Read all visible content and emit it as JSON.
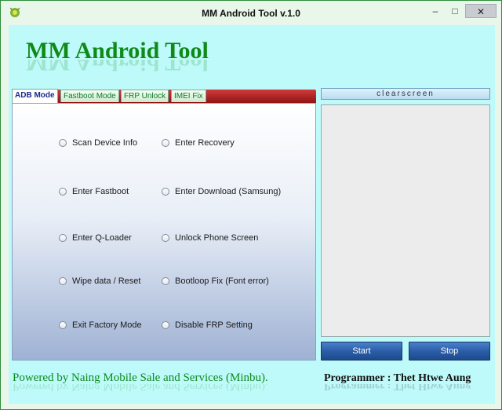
{
  "window": {
    "title": "MM Android Tool v.1.0",
    "controls": {
      "minimize": "–",
      "maximize": "□",
      "close": "✕"
    }
  },
  "app": {
    "title": "MM Android Tool"
  },
  "tabs": [
    {
      "label": "ADB Mode",
      "active": true
    },
    {
      "label": "Fastboot Mode",
      "active": false
    },
    {
      "label": "FRP Unlock",
      "active": false
    },
    {
      "label": "IMEI Fix",
      "active": false
    }
  ],
  "options": {
    "left": [
      "Scan Device Info",
      "Enter Fastboot",
      "Enter Q-Loader",
      "Wipe data / Reset",
      "Exit Factory Mode"
    ],
    "right": [
      "Enter Recovery",
      "Enter Download (Samsung)",
      "Unlock Phone Screen",
      "Bootloop Fix (Font error)",
      "Disable FRP Setting"
    ]
  },
  "log": {
    "clear_label": "clearscreen",
    "content": ""
  },
  "buttons": {
    "start": "Start",
    "stop": "Stop"
  },
  "footer": {
    "powered_by": "Powered by Naing Mobile Sale and Services (Minbu).",
    "programmer": "Programmer : Thet Htwe Aung"
  },
  "colors": {
    "accent_green": "#0e8a18",
    "client_background": "#bffafa",
    "tab_band_red": "#b02020",
    "button_blue": "#2c5ea8"
  },
  "icons": {
    "app": "android-app-icon"
  }
}
